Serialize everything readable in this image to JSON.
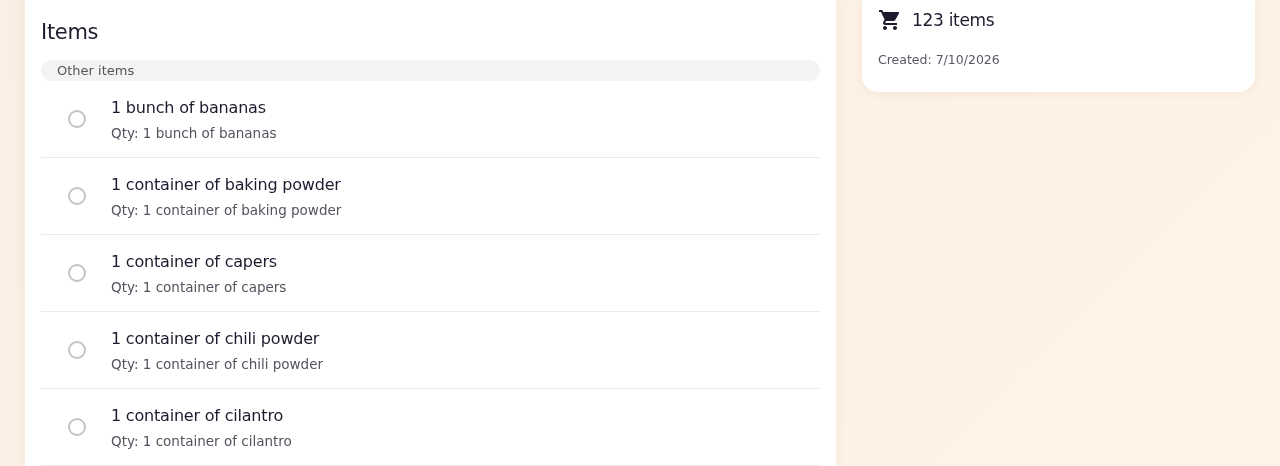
{
  "items_panel": {
    "title": "Items",
    "group": {
      "label": "Other items",
      "items": [
        {
          "name": "1 bunch of bananas",
          "qty": "Qty: 1 bunch of bananas",
          "checked": false
        },
        {
          "name": "1 container of baking powder",
          "qty": "Qty: 1 container of baking powder",
          "checked": false
        },
        {
          "name": "1 container of capers",
          "qty": "Qty: 1 container of capers",
          "checked": false
        },
        {
          "name": "1 container of chili powder",
          "qty": "Qty: 1 container of chili powder",
          "checked": false
        },
        {
          "name": "1 container of cilantro",
          "qty": "Qty: 1 container of cilantro",
          "checked": false
        }
      ]
    }
  },
  "summary_card": {
    "count": "123 items",
    "created": "Created: 7/10/2026"
  }
}
